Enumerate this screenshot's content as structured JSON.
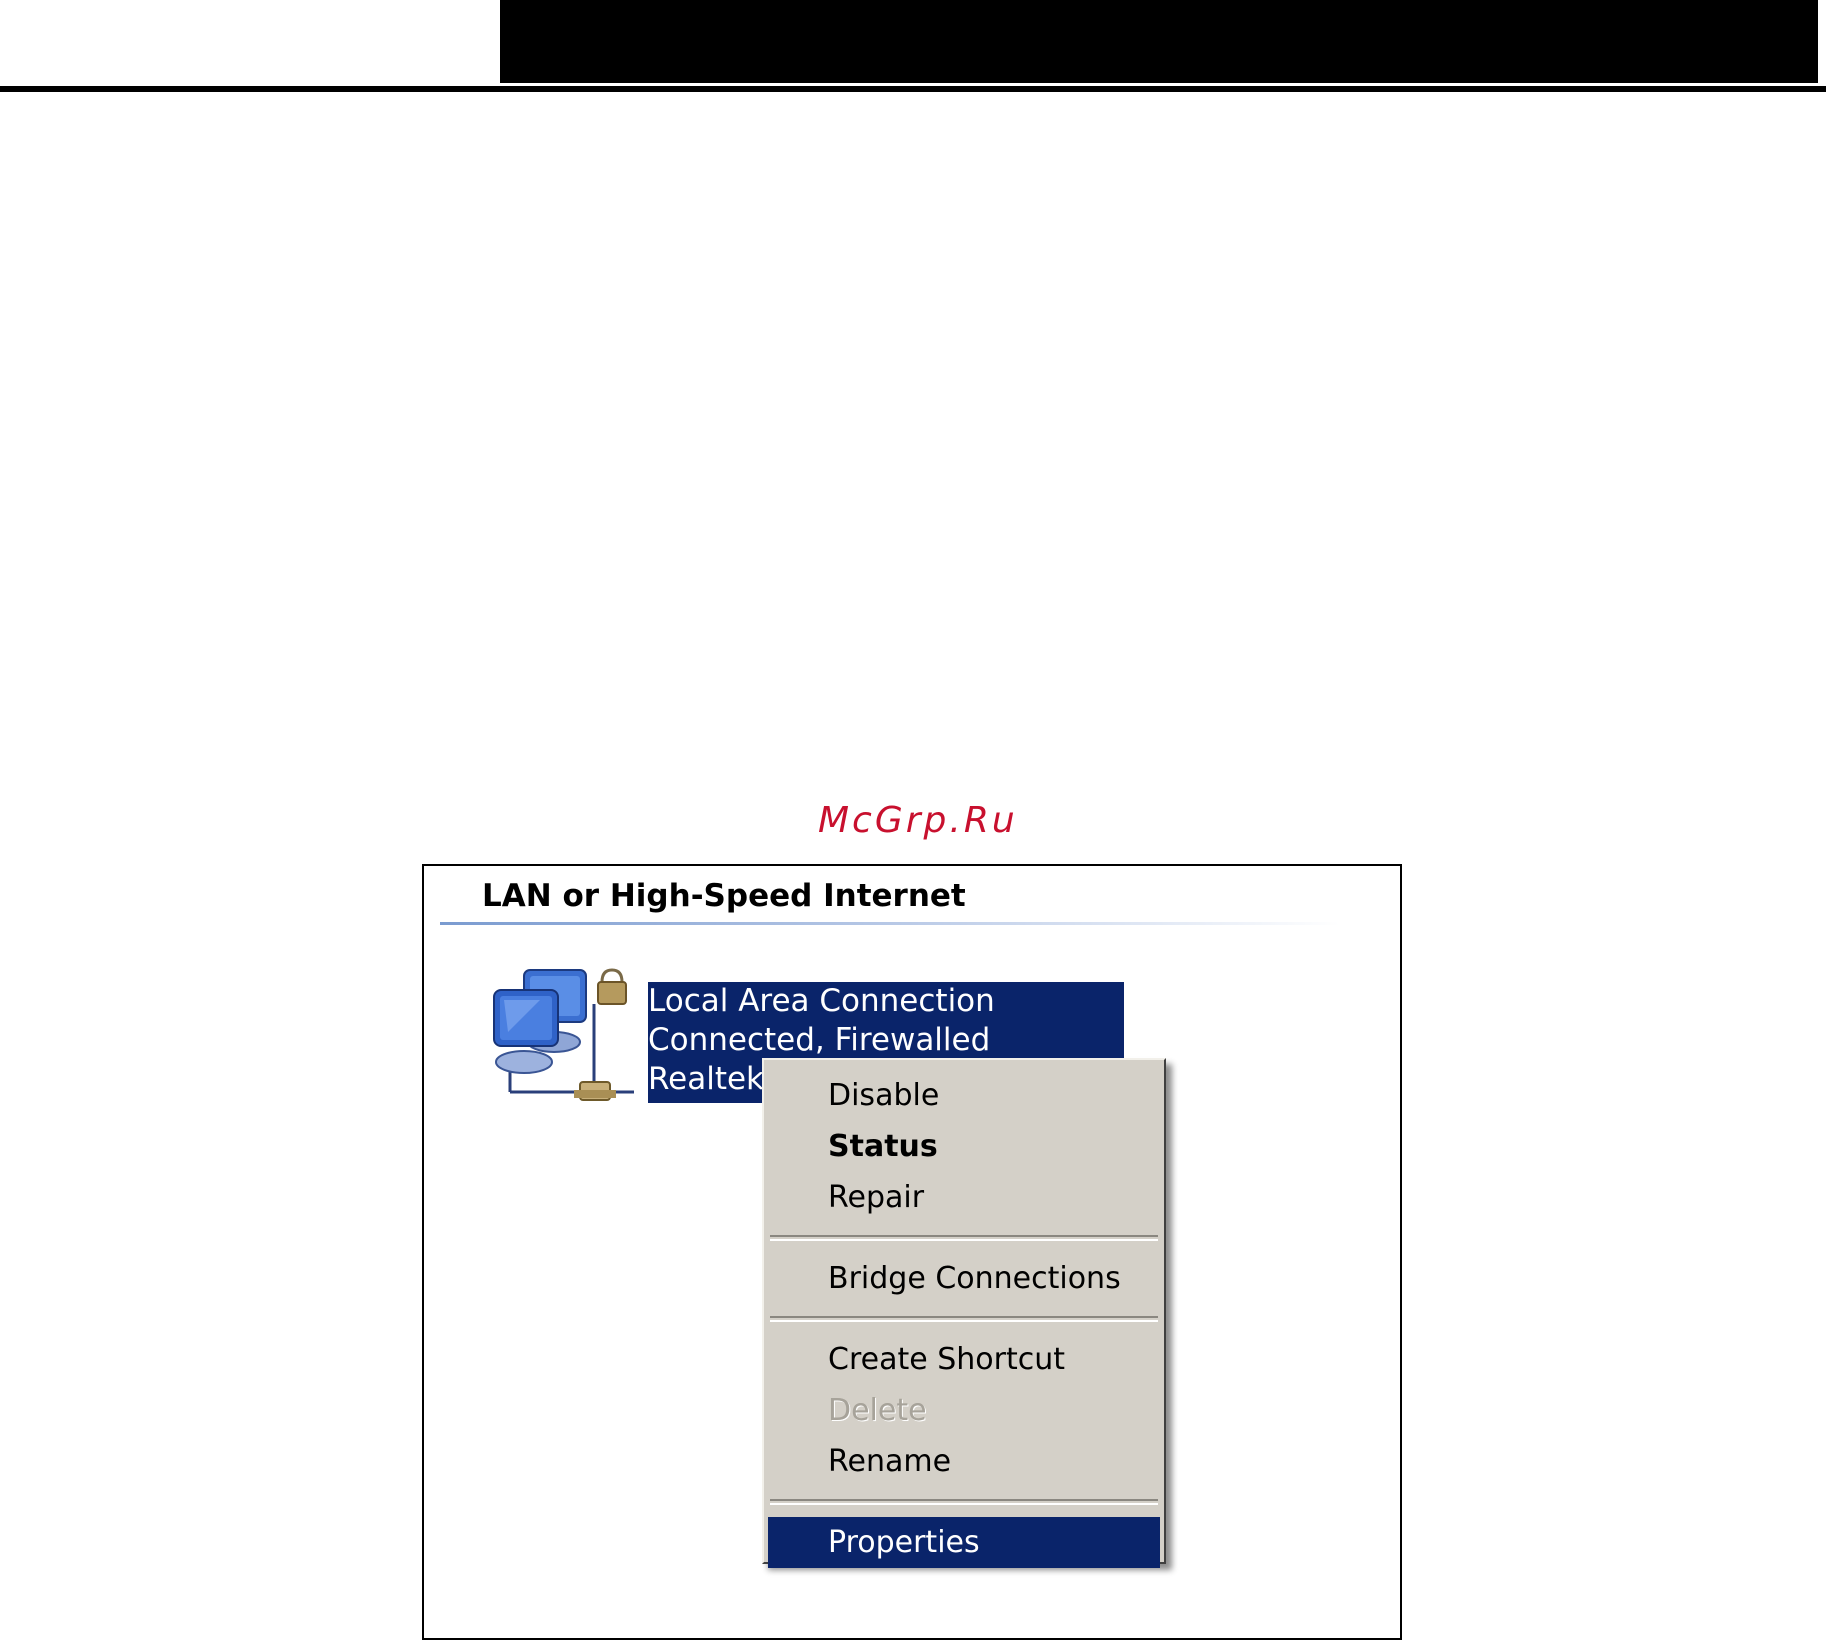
{
  "watermark": "McGrp.Ru",
  "group": {
    "title": "LAN or High-Speed Internet"
  },
  "connection": {
    "name": "Local Area Connection",
    "status": "Connected, Firewalled",
    "device": "Realtek"
  },
  "context_menu": {
    "items": [
      {
        "label": "Disable"
      },
      {
        "label": "Status"
      },
      {
        "label": "Repair"
      },
      {
        "label": "Bridge Connections"
      },
      {
        "label": "Create Shortcut"
      },
      {
        "label": "Delete"
      },
      {
        "label": "Rename"
      },
      {
        "label": "Properties"
      }
    ]
  },
  "colors": {
    "selection": "#0a246a",
    "menu_background": "#d4d0c8",
    "watermark": "#c8102e"
  },
  "icons": {
    "connection": "network-computers-icon",
    "lock": "lock-icon"
  }
}
